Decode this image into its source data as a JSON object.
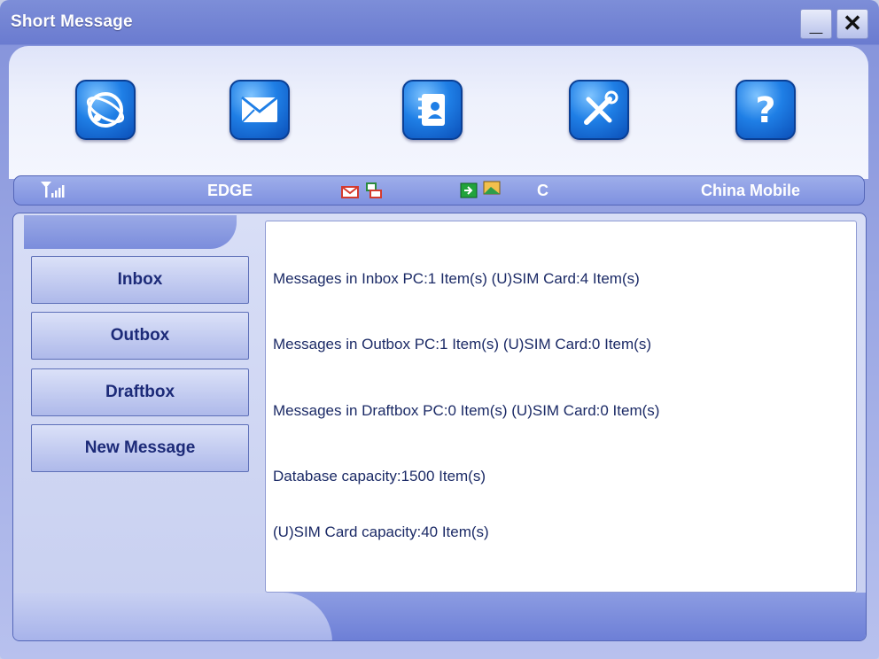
{
  "window": {
    "title": "Short Message",
    "minimize_label": "_",
    "close_label": "✕"
  },
  "toolbar": {
    "items": [
      {
        "name": "internet",
        "icon": "globe-icon"
      },
      {
        "name": "sms",
        "icon": "envelope-icon"
      },
      {
        "name": "contacts",
        "icon": "phonebook-icon"
      },
      {
        "name": "settings",
        "icon": "tools-icon"
      },
      {
        "name": "help",
        "icon": "help-icon"
      }
    ]
  },
  "status": {
    "signal_icon": "signal-strength-icon",
    "network": "EDGE",
    "mode": "C",
    "operator": "China Mobile"
  },
  "nav": {
    "inbox": "Inbox",
    "outbox": "Outbox",
    "draftbox": "Draftbox",
    "new_message": "New Message"
  },
  "summary": {
    "inbox": "Messages in Inbox PC:1 Item(s)  (U)SIM Card:4 Item(s)",
    "outbox": "Messages in Outbox PC:1 Item(s)  (U)SIM Card:0 Item(s)",
    "draftbox": "Messages in Draftbox PC:0 Item(s)  (U)SIM Card:0 Item(s)",
    "db_capacity": "Database capacity:1500 Item(s)",
    "sim_capacity": "(U)SIM Card capacity:40 Item(s)"
  },
  "colors": {
    "accent": "#1f7fe6",
    "title_bar": "#6a7bd0",
    "text": "#1b2a66"
  }
}
